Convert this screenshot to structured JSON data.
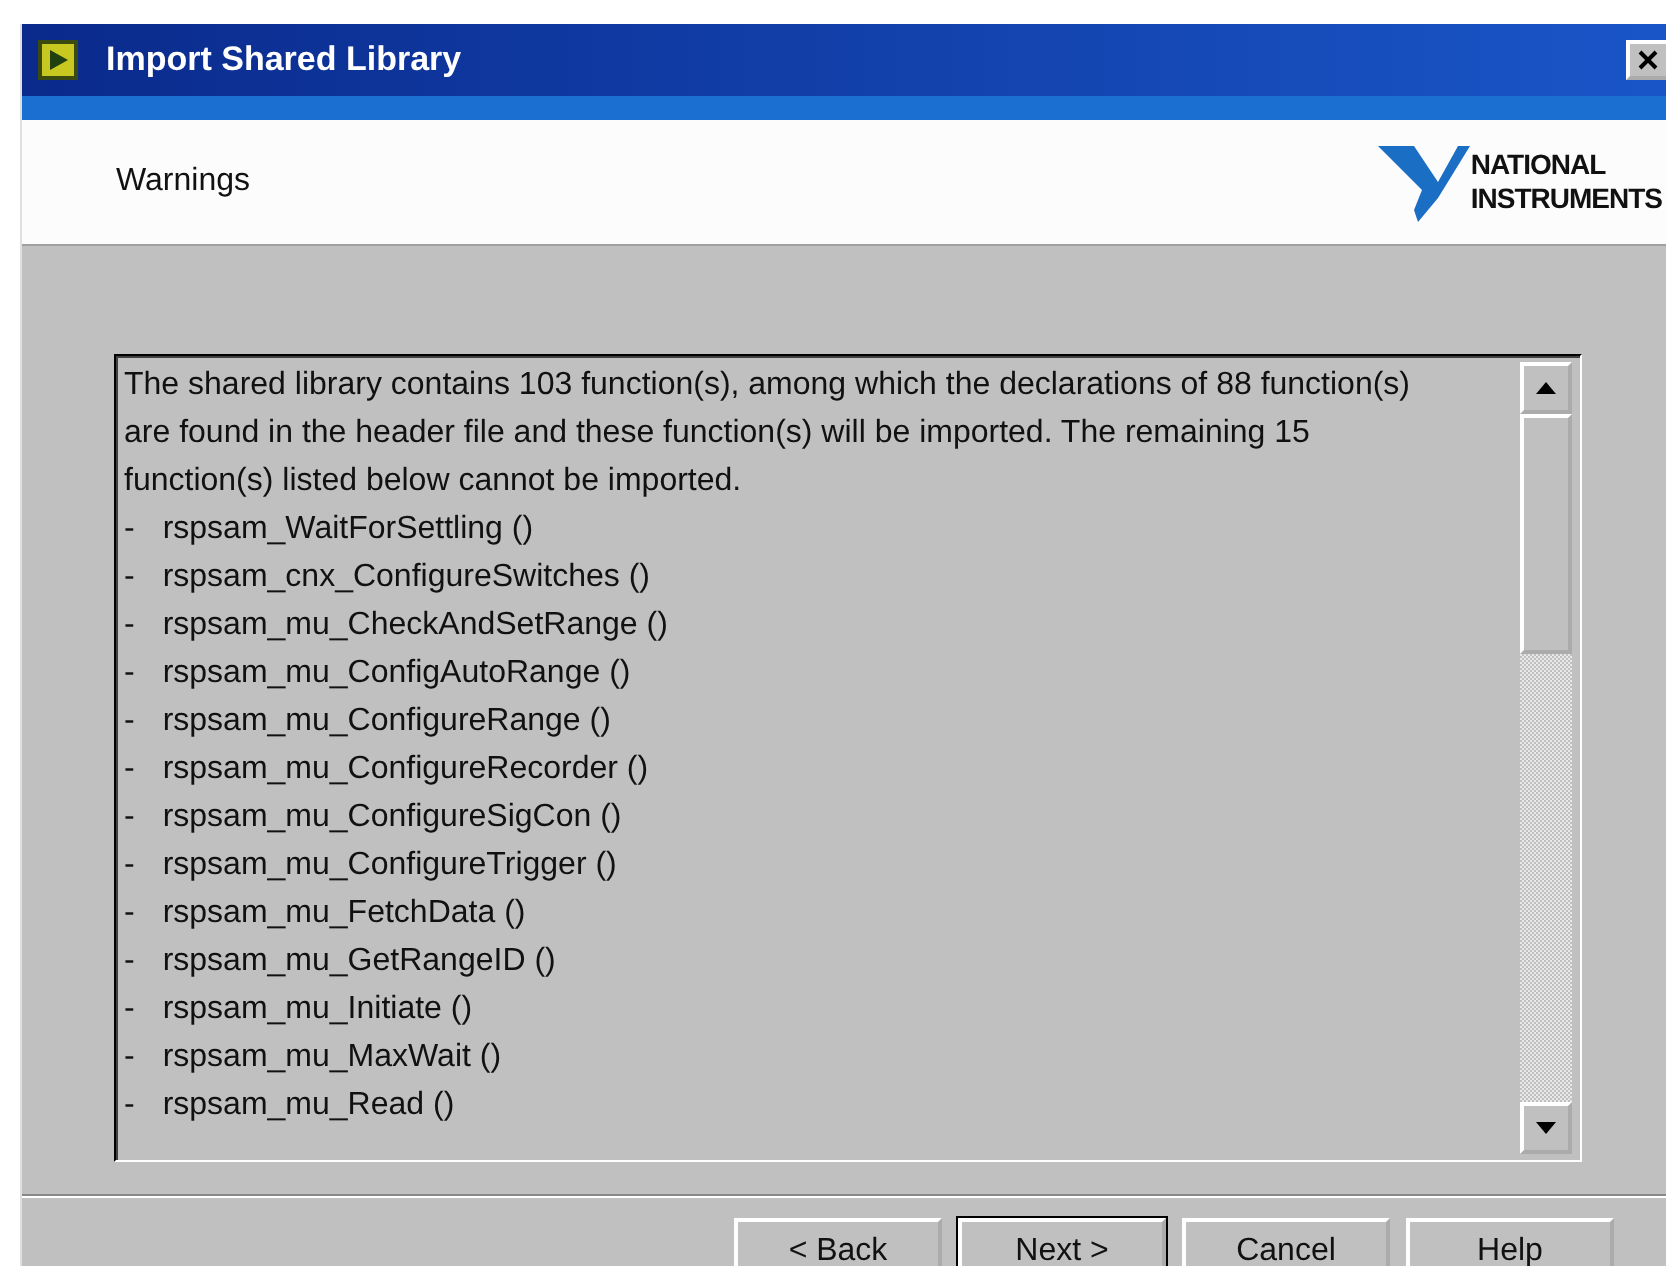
{
  "window": {
    "title": "Import Shared Library"
  },
  "header": {
    "heading": "Warnings",
    "logo_lines": [
      "NATIONAL",
      "INSTRUMENTS"
    ]
  },
  "message": {
    "intro": "The shared library contains 103 function(s), among which the declarations of 88 function(s) are found in the header file and these function(s) will be imported. The remaining 15 function(s) listed below cannot be imported.",
    "items": [
      {
        "bullet": "-",
        "text": "rspsam_WaitForSettling ()"
      },
      {
        "bullet": "-",
        "text": "rspsam_cnx_ConfigureSwitches ()"
      },
      {
        "bullet": "-",
        "text": "rspsam_mu_CheckAndSetRange ()"
      },
      {
        "bullet": "-",
        "text": "rspsam_mu_ConfigAutoRange ()"
      },
      {
        "bullet": "-",
        "text": "rspsam_mu_ConfigureRange ()"
      },
      {
        "bullet": "-",
        "text": "rspsam_mu_ConfigureRecorder ()"
      },
      {
        "bullet": "-",
        "text": "rspsam_mu_ConfigureSigCon ()"
      },
      {
        "bullet": "-",
        "text": "rspsam_mu_ConfigureTrigger ()"
      },
      {
        "bullet": "-",
        "text": "rspsam_mu_FetchData ()"
      },
      {
        "bullet": "-",
        "text": "rspsam_mu_GetRangeID ()"
      },
      {
        "bullet": "-",
        "text": "rspsam_mu_Initiate ()"
      },
      {
        "bullet": "-",
        "text": "rspsam_mu_MaxWait ()"
      },
      {
        "bullet": "-",
        "text": "rspsam_mu_Read ()"
      }
    ]
  },
  "buttons": [
    {
      "label": "< Back",
      "default": false
    },
    {
      "label": "Next >",
      "default": true
    },
    {
      "label": "Cancel",
      "default": false
    },
    {
      "label": "Help",
      "default": false
    }
  ]
}
